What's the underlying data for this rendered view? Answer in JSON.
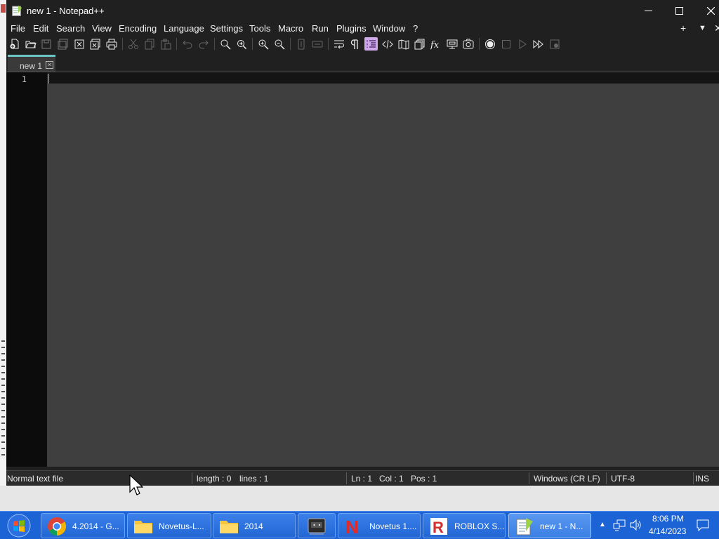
{
  "window": {
    "title": "new 1 - Notepad++",
    "controls": {
      "minimize": "—",
      "maximize": "☐",
      "close": "✕"
    }
  },
  "menu": [
    "File",
    "Edit",
    "Search",
    "View",
    "Encoding",
    "Language",
    "Settings",
    "Tools",
    "Macro",
    "Run",
    "Plugins",
    "Window",
    "?"
  ],
  "menu_right": {
    "add": "+",
    "dropdown": "▼",
    "close": "✕"
  },
  "tab": {
    "label": "new 1",
    "close": "×"
  },
  "editor": {
    "line_number": "1"
  },
  "status": {
    "file_type": "Normal text file",
    "length": "length : 0",
    "lines": "lines : 1",
    "ln": "Ln : 1",
    "col": "Col : 1",
    "pos": "Pos : 1",
    "eol": "Windows (CR LF)",
    "encoding": "UTF-8",
    "mode": "INS"
  },
  "taskbar": {
    "items": [
      {
        "label": "4.2014 - G...",
        "icon": "chrome-icon"
      },
      {
        "label": "Novetus-L...",
        "icon": "folder-icon"
      },
      {
        "label": "2014",
        "icon": "folder-icon"
      },
      {
        "label": "",
        "icon": "app-window-icon"
      },
      {
        "label": "Novetus 1....",
        "icon": "novetus-icon"
      },
      {
        "label": "ROBLOX S...",
        "icon": "roblox-icon"
      },
      {
        "label": "new 1 - N...",
        "icon": "notepadpp-icon"
      }
    ],
    "clock_time": "8:06 PM",
    "clock_date": "4/14/2023",
    "show_hidden": "▲"
  },
  "colors": {
    "taskbar": "#1c63d6",
    "editor_bg": "#3f3f3f",
    "gutter_bg": "#0c0c0c",
    "titlebar": "#202020",
    "tab_accent": "#6cc4c4",
    "active_tool": "#cfa8ea"
  }
}
